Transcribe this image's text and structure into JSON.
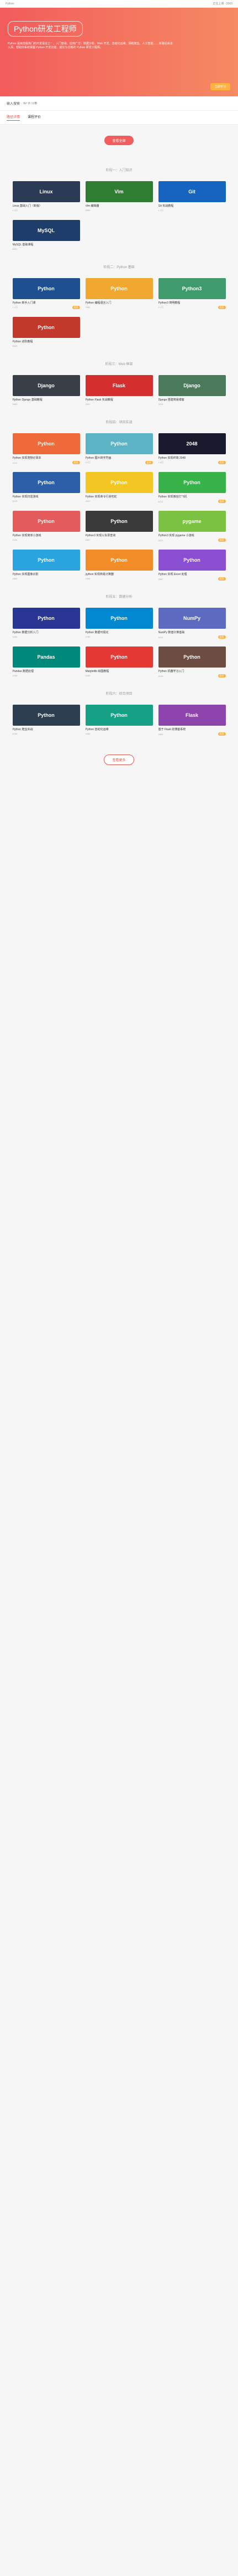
{
  "topbar": {
    "left": "Python",
    "right": "· 正在上课 · 2000"
  },
  "hero": {
    "title": "Python研发工程师",
    "desc": "Python 是目前最热门的开发语言之一，入门容易、应用广泛：数据分析、Web 开发、自动化运维、网络爬虫、人工智能……本路径由浅入深，帮助你系统掌握 Python 开发技能，成长为合格的 Python 研发工程师。",
    "cta": "立即学习"
  },
  "search": {
    "label": "输入搜索",
    "placeholder": "ID 学习本"
  },
  "tabs": [
    "路径详情",
    "课程评价"
  ],
  "category_btn": "查看全部",
  "sections": [
    {
      "title": "阶段一：入门知识",
      "items": [
        {
          "title": "Linux 基础入门（新版）",
          "color": "#2b3a55",
          "tag": "Linux",
          "meta": "1.3万",
          "badge": ""
        },
        {
          "title": "Vim 编辑器",
          "color": "#2e7d32",
          "tag": "Vim",
          "meta": "9896",
          "badge": ""
        },
        {
          "title": "Git 实战教程",
          "color": "#1565c0",
          "tag": "Git",
          "meta": "1.2万",
          "badge": ""
        },
        {
          "title": "MySQL 基础课程",
          "color": "#1e3d6b",
          "tag": "MySQL",
          "meta": "8921",
          "badge": ""
        }
      ]
    },
    {
      "title": "阶段二：Python 基础",
      "items": [
        {
          "title": "Python 新手入门课",
          "color": "#1d4f91",
          "tag": "Python",
          "meta": "1.1万",
          "badge": "会员"
        },
        {
          "title": "Python 编程语言入门",
          "color": "#f0a830",
          "tag": "Python",
          "meta": "7682",
          "badge": ""
        },
        {
          "title": "Python3 简明教程",
          "color": "#3f9b6d",
          "tag": "Python3",
          "meta": "2.1万",
          "badge": "会员"
        },
        {
          "title": "Python 进阶教程",
          "color": "#c0392b",
          "tag": "Python",
          "meta": "6543",
          "badge": ""
        }
      ]
    },
    {
      "title": "阶段三：Web 框架",
      "items": [
        {
          "title": "Python Django 基础教程",
          "color": "#3a3f47",
          "tag": "Django",
          "meta": "5689",
          "badge": ""
        },
        {
          "title": "Python Flask 实战教程",
          "color": "#d32f2f",
          "tag": "Flask",
          "meta": "4521",
          "badge": ""
        },
        {
          "title": "Django 搭建简易博客",
          "color": "#4a7a5a",
          "tag": "Django",
          "meta": "3210",
          "badge": ""
        }
      ]
    },
    {
      "title": "阶段四：项目实战",
      "items": [
        {
          "title": "Python 实现宠物记事本",
          "color": "#ef6a3a",
          "tag": "Python",
          "meta": "4211",
          "badge": "会员"
        },
        {
          "title": "Python 图片转字符画",
          "color": "#5db3c6",
          "tag": "Python",
          "meta": "3.2万",
          "badge": "会员"
        },
        {
          "title": "Python 实现终端 2048",
          "color": "#1a1a2e",
          "tag": "2048",
          "meta": "1.8万",
          "badge": "会员"
        },
        {
          "title": "Python 实现扫雷游戏",
          "color": "#2d5fa8",
          "tag": "Python",
          "meta": "5123",
          "badge": ""
        },
        {
          "title": "Python 实现命令行贪吃蛇",
          "color": "#f3c623",
          "tag": "Python",
          "meta": "4321",
          "badge": ""
        },
        {
          "title": "Python 实现微信打飞机",
          "color": "#37b34a",
          "tag": "Python",
          "meta": "6211",
          "badge": "会员"
        },
        {
          "title": "Python 实现简单小游戏",
          "color": "#e45b5b",
          "tag": "Python",
          "meta": "2134",
          "badge": ""
        },
        {
          "title": "Python3 实现火车票查询",
          "color": "#3a3a3a",
          "tag": "Python",
          "meta": "4567",
          "badge": ""
        },
        {
          "title": "Python3 实现 pygame 小游戏",
          "color": "#7cc242",
          "tag": "pygame",
          "meta": "3321",
          "badge": "会员"
        },
        {
          "title": "Python 实现图像识别",
          "color": "#29a4de",
          "tag": "Python",
          "meta": "2890",
          "badge": ""
        },
        {
          "title": "python 实现简易计算器",
          "color": "#f28c28",
          "tag": "Python",
          "meta": "1998",
          "badge": ""
        },
        {
          "title": "Python 实现 Excel 处理",
          "color": "#8a4fd1",
          "tag": "Python",
          "meta": "2567",
          "badge": "会员"
        }
      ]
    },
    {
      "title": "阶段五：数据分析",
      "items": [
        {
          "title": "Python 数据分析入门",
          "color": "#283593",
          "tag": "Python",
          "meta": "3456",
          "badge": ""
        },
        {
          "title": "Python 数据可视化",
          "color": "#0288d1",
          "tag": "Python",
          "meta": "2789",
          "badge": ""
        },
        {
          "title": "NumPy 数值计算基础",
          "color": "#5c6bc0",
          "tag": "NumPy",
          "meta": "4012",
          "badge": "会员"
        },
        {
          "title": "Pandas 数据处理",
          "color": "#00897b",
          "tag": "Pandas",
          "meta": "3789",
          "badge": ""
        },
        {
          "title": "Matplotlib 绘图教程",
          "color": "#e53935",
          "tag": "Python",
          "meta": "2345",
          "badge": ""
        },
        {
          "title": "Python 机器学习入门",
          "color": "#6d4c41",
          "tag": "Python",
          "meta": "5123",
          "badge": "会员"
        }
      ]
    },
    {
      "title": "阶段六：综合项目",
      "items": [
        {
          "title": "Python 爬虫实战",
          "color": "#2c3e50",
          "tag": "Python",
          "meta": "6789",
          "badge": ""
        },
        {
          "title": "Python 自动化运维",
          "color": "#16a085",
          "tag": "Python",
          "meta": "3456",
          "badge": ""
        },
        {
          "title": "基于 Flask 的博客系统",
          "color": "#8e44ad",
          "tag": "Flask",
          "meta": "2890",
          "badge": "会员"
        }
      ]
    }
  ],
  "more_btn": "查看更多"
}
